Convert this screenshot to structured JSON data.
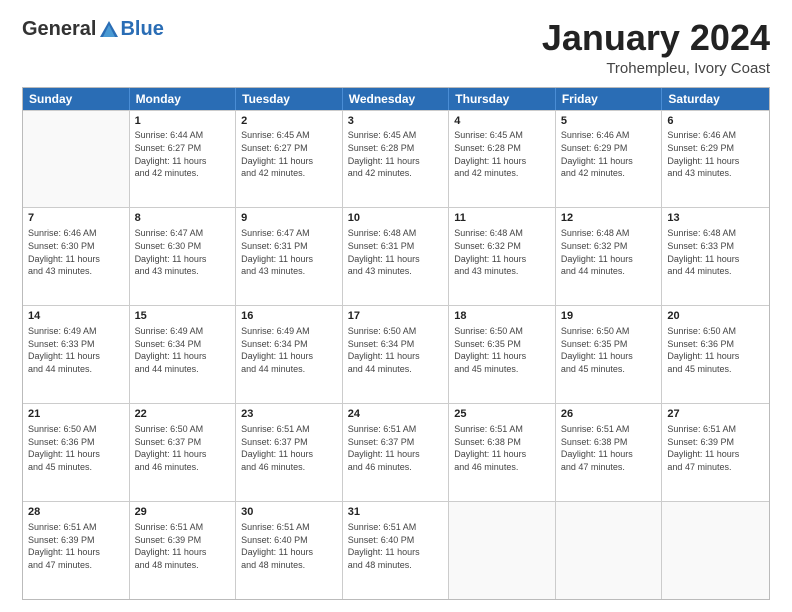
{
  "header": {
    "logo_general": "General",
    "logo_blue": "Blue",
    "title": "January 2024",
    "subtitle": "Trohempleu, Ivory Coast"
  },
  "calendar": {
    "days": [
      "Sunday",
      "Monday",
      "Tuesday",
      "Wednesday",
      "Thursday",
      "Friday",
      "Saturday"
    ],
    "rows": [
      [
        {
          "day": "",
          "empty": true
        },
        {
          "day": "1",
          "lines": [
            "Sunrise: 6:44 AM",
            "Sunset: 6:27 PM",
            "Daylight: 11 hours",
            "and 42 minutes."
          ]
        },
        {
          "day": "2",
          "lines": [
            "Sunrise: 6:45 AM",
            "Sunset: 6:27 PM",
            "Daylight: 11 hours",
            "and 42 minutes."
          ]
        },
        {
          "day": "3",
          "lines": [
            "Sunrise: 6:45 AM",
            "Sunset: 6:28 PM",
            "Daylight: 11 hours",
            "and 42 minutes."
          ]
        },
        {
          "day": "4",
          "lines": [
            "Sunrise: 6:45 AM",
            "Sunset: 6:28 PM",
            "Daylight: 11 hours",
            "and 42 minutes."
          ]
        },
        {
          "day": "5",
          "lines": [
            "Sunrise: 6:46 AM",
            "Sunset: 6:29 PM",
            "Daylight: 11 hours",
            "and 42 minutes."
          ]
        },
        {
          "day": "6",
          "lines": [
            "Sunrise: 6:46 AM",
            "Sunset: 6:29 PM",
            "Daylight: 11 hours",
            "and 43 minutes."
          ]
        }
      ],
      [
        {
          "day": "7",
          "lines": [
            "Sunrise: 6:46 AM",
            "Sunset: 6:30 PM",
            "Daylight: 11 hours",
            "and 43 minutes."
          ]
        },
        {
          "day": "8",
          "lines": [
            "Sunrise: 6:47 AM",
            "Sunset: 6:30 PM",
            "Daylight: 11 hours",
            "and 43 minutes."
          ]
        },
        {
          "day": "9",
          "lines": [
            "Sunrise: 6:47 AM",
            "Sunset: 6:31 PM",
            "Daylight: 11 hours",
            "and 43 minutes."
          ]
        },
        {
          "day": "10",
          "lines": [
            "Sunrise: 6:48 AM",
            "Sunset: 6:31 PM",
            "Daylight: 11 hours",
            "and 43 minutes."
          ]
        },
        {
          "day": "11",
          "lines": [
            "Sunrise: 6:48 AM",
            "Sunset: 6:32 PM",
            "Daylight: 11 hours",
            "and 43 minutes."
          ]
        },
        {
          "day": "12",
          "lines": [
            "Sunrise: 6:48 AM",
            "Sunset: 6:32 PM",
            "Daylight: 11 hours",
            "and 44 minutes."
          ]
        },
        {
          "day": "13",
          "lines": [
            "Sunrise: 6:48 AM",
            "Sunset: 6:33 PM",
            "Daylight: 11 hours",
            "and 44 minutes."
          ]
        }
      ],
      [
        {
          "day": "14",
          "lines": [
            "Sunrise: 6:49 AM",
            "Sunset: 6:33 PM",
            "Daylight: 11 hours",
            "and 44 minutes."
          ]
        },
        {
          "day": "15",
          "lines": [
            "Sunrise: 6:49 AM",
            "Sunset: 6:34 PM",
            "Daylight: 11 hours",
            "and 44 minutes."
          ]
        },
        {
          "day": "16",
          "lines": [
            "Sunrise: 6:49 AM",
            "Sunset: 6:34 PM",
            "Daylight: 11 hours",
            "and 44 minutes."
          ]
        },
        {
          "day": "17",
          "lines": [
            "Sunrise: 6:50 AM",
            "Sunset: 6:34 PM",
            "Daylight: 11 hours",
            "and 44 minutes."
          ]
        },
        {
          "day": "18",
          "lines": [
            "Sunrise: 6:50 AM",
            "Sunset: 6:35 PM",
            "Daylight: 11 hours",
            "and 45 minutes."
          ]
        },
        {
          "day": "19",
          "lines": [
            "Sunrise: 6:50 AM",
            "Sunset: 6:35 PM",
            "Daylight: 11 hours",
            "and 45 minutes."
          ]
        },
        {
          "day": "20",
          "lines": [
            "Sunrise: 6:50 AM",
            "Sunset: 6:36 PM",
            "Daylight: 11 hours",
            "and 45 minutes."
          ]
        }
      ],
      [
        {
          "day": "21",
          "lines": [
            "Sunrise: 6:50 AM",
            "Sunset: 6:36 PM",
            "Daylight: 11 hours",
            "and 45 minutes."
          ]
        },
        {
          "day": "22",
          "lines": [
            "Sunrise: 6:50 AM",
            "Sunset: 6:37 PM",
            "Daylight: 11 hours",
            "and 46 minutes."
          ]
        },
        {
          "day": "23",
          "lines": [
            "Sunrise: 6:51 AM",
            "Sunset: 6:37 PM",
            "Daylight: 11 hours",
            "and 46 minutes."
          ]
        },
        {
          "day": "24",
          "lines": [
            "Sunrise: 6:51 AM",
            "Sunset: 6:37 PM",
            "Daylight: 11 hours",
            "and 46 minutes."
          ]
        },
        {
          "day": "25",
          "lines": [
            "Sunrise: 6:51 AM",
            "Sunset: 6:38 PM",
            "Daylight: 11 hours",
            "and 46 minutes."
          ]
        },
        {
          "day": "26",
          "lines": [
            "Sunrise: 6:51 AM",
            "Sunset: 6:38 PM",
            "Daylight: 11 hours",
            "and 47 minutes."
          ]
        },
        {
          "day": "27",
          "lines": [
            "Sunrise: 6:51 AM",
            "Sunset: 6:39 PM",
            "Daylight: 11 hours",
            "and 47 minutes."
          ]
        }
      ],
      [
        {
          "day": "28",
          "lines": [
            "Sunrise: 6:51 AM",
            "Sunset: 6:39 PM",
            "Daylight: 11 hours",
            "and 47 minutes."
          ]
        },
        {
          "day": "29",
          "lines": [
            "Sunrise: 6:51 AM",
            "Sunset: 6:39 PM",
            "Daylight: 11 hours",
            "and 48 minutes."
          ]
        },
        {
          "day": "30",
          "lines": [
            "Sunrise: 6:51 AM",
            "Sunset: 6:40 PM",
            "Daylight: 11 hours",
            "and 48 minutes."
          ]
        },
        {
          "day": "31",
          "lines": [
            "Sunrise: 6:51 AM",
            "Sunset: 6:40 PM",
            "Daylight: 11 hours",
            "and 48 minutes."
          ]
        },
        {
          "day": "",
          "empty": true
        },
        {
          "day": "",
          "empty": true
        },
        {
          "day": "",
          "empty": true
        }
      ]
    ]
  }
}
